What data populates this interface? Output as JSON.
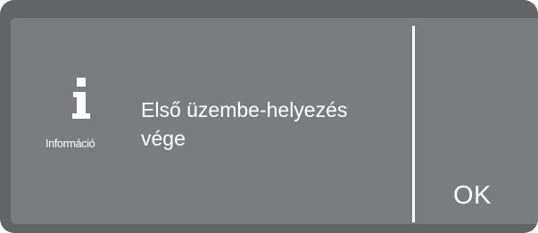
{
  "dialog": {
    "icon": "info-icon",
    "icon_caption": "Információ",
    "message_line1": "Első üzembe-helyezés",
    "message_line2": "vége",
    "ok_label": "OK"
  },
  "colors": {
    "bezel": "#636466",
    "screen": "#7b7c7e",
    "text": "#ffffff"
  }
}
